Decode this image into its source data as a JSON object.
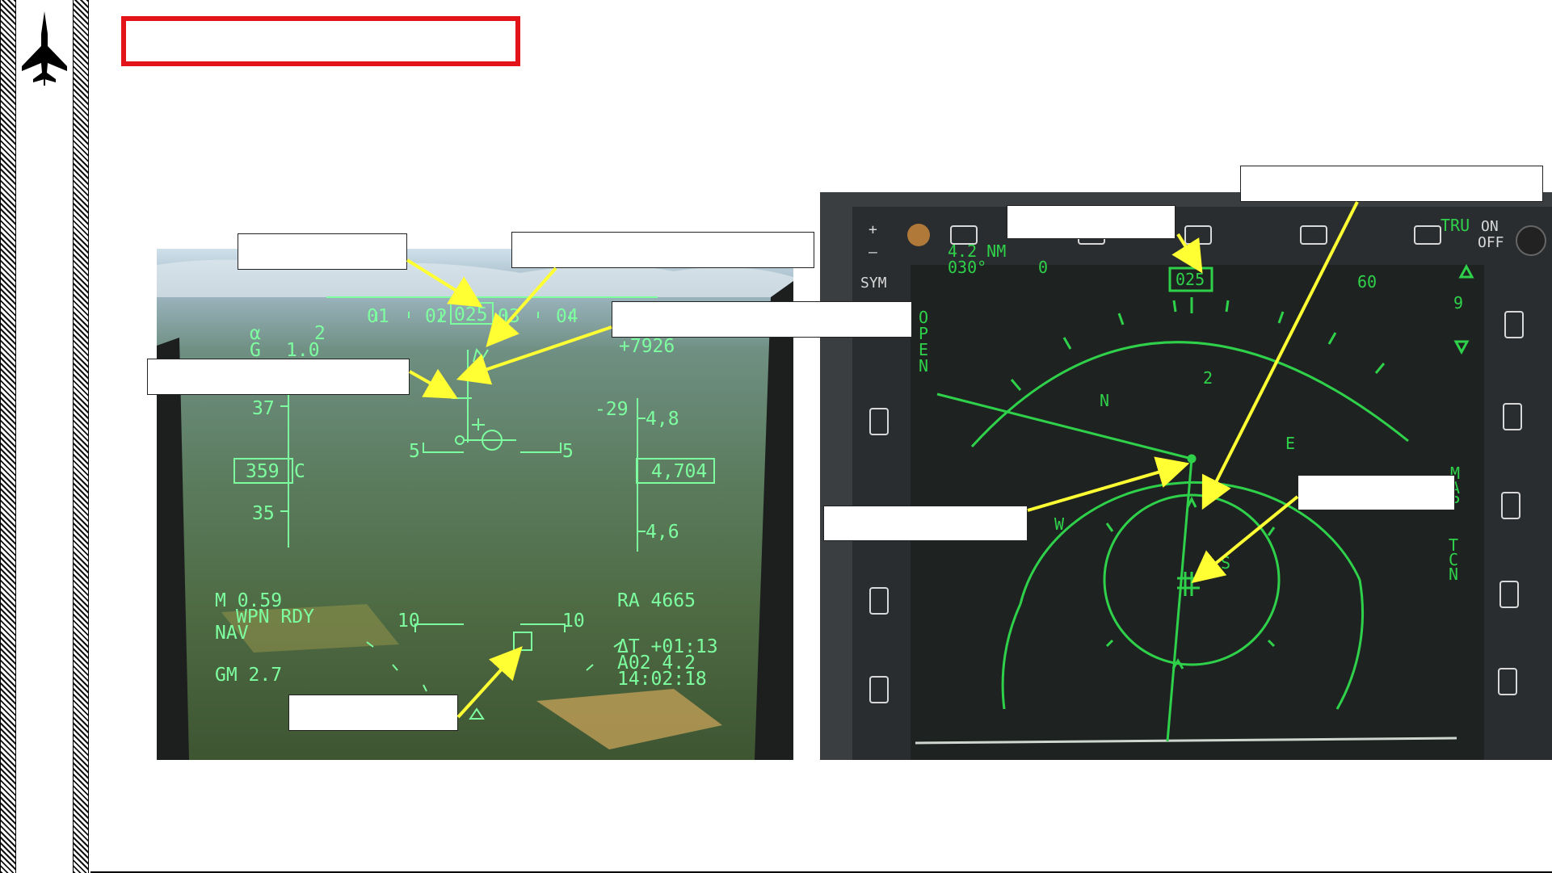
{
  "hud": {
    "heading_box": "025",
    "heading_ticks": [
      "01",
      "02",
      "03",
      "04"
    ],
    "alpha_label": "α",
    "alpha_value": "2",
    "g_label": "G",
    "g_value": "1.0",
    "altitude_gain": "+7926",
    "speed_upper": "37",
    "speed_box": "359",
    "speed_box_suffix": "C",
    "speed_lower": "35",
    "pitch_upper_left": "5",
    "pitch_upper_right": "5",
    "pitch_lower_left": "10",
    "pitch_lower_right": "10",
    "alt_upper": "4,8",
    "alt_box": "4,704",
    "alt_lower": "4,6",
    "vvi": "-29",
    "mach": "M 0.59",
    "weapon_status": "WPN RDY",
    "mode": "NAV",
    "gm": "GM 2.7",
    "radar_alt": "RA   4665",
    "delta_t": "ΔT +01:13",
    "waypoint": "A02 4.2",
    "clock": "14:02:18"
  },
  "mfd": {
    "on_label": "ON",
    "off_label": "OFF",
    "sym_label": "SYM",
    "plus_label": "+",
    "minus_label": "–",
    "range_nm": "4.2 NM",
    "bearing": "030°",
    "heading_box": "025",
    "tru_label": "TRU",
    "arc_label_0": "0",
    "arc_label_60": "60",
    "open_letters": [
      "O",
      "P",
      "E",
      "N"
    ],
    "map_letters": [
      "M",
      "A",
      "P"
    ],
    "tcn_letters": [
      "T",
      "C",
      "N"
    ],
    "right_value": "9",
    "waypoint_num": "2",
    "compass": {
      "n": "N",
      "e": "E",
      "s": "S",
      "w": "W"
    }
  },
  "colors": {
    "hud_symbology": "#7dffa0",
    "mfd_symbology": "#2fd14a",
    "arrow": "#ffff33",
    "title_border": "#e2141a"
  }
}
